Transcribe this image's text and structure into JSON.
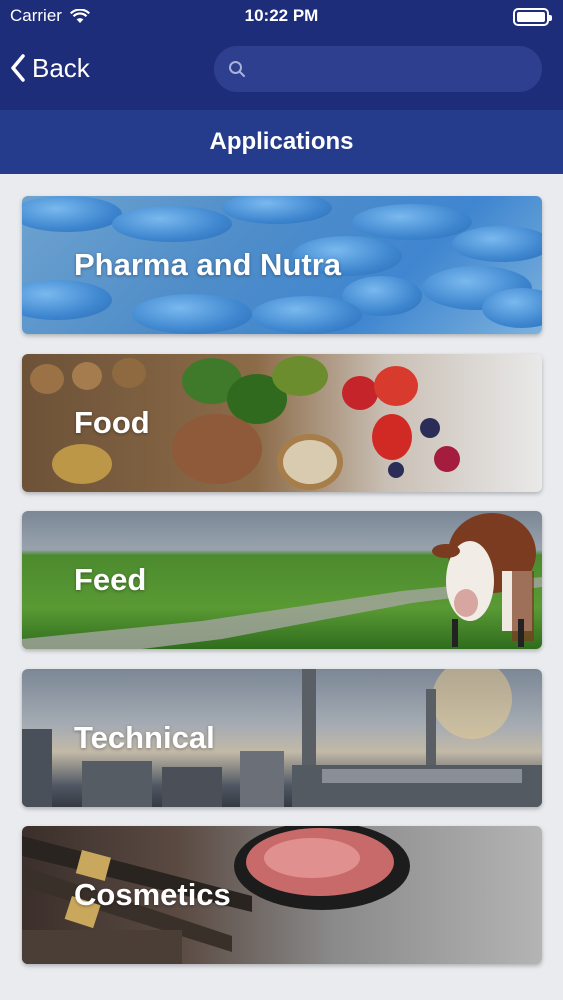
{
  "status_bar": {
    "carrier": "Carrier",
    "time": "10:22 PM"
  },
  "nav": {
    "back_label": "Back",
    "search_placeholder": ""
  },
  "header": {
    "title": "Applications"
  },
  "categories": [
    {
      "label": "Pharma and Nutra"
    },
    {
      "label": "Food"
    },
    {
      "label": "Feed"
    },
    {
      "label": "Technical"
    },
    {
      "label": "Cosmetics"
    }
  ],
  "colors": {
    "nav_bar": "#1e2d7a",
    "header_bar": "#253b8c",
    "background": "#e9ebee"
  }
}
